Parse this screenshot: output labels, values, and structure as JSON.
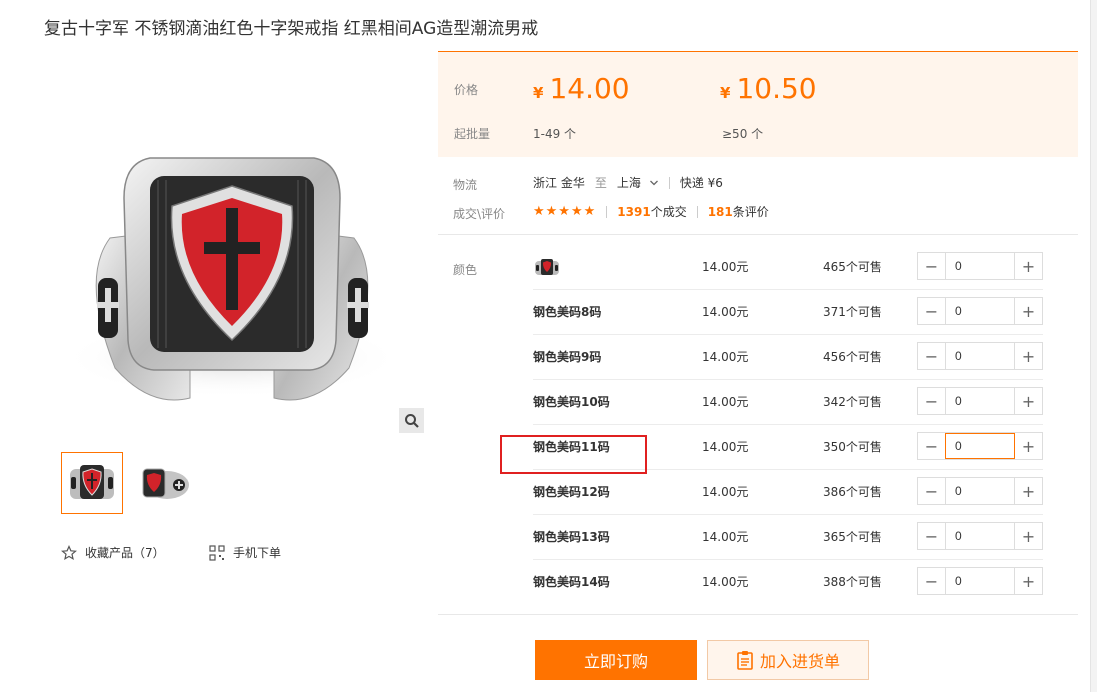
{
  "product": {
    "title": "复古十字军 不锈钢滴油红色十字架戒指 红黑相间AG造型潮流男戒"
  },
  "gallery": {
    "favorite_label": "收藏产品（7）",
    "mobile_label": "手机下单"
  },
  "price_box": {
    "price_label": "价格",
    "currency": "¥",
    "tiers": [
      {
        "price": "14.00",
        "moq": "1-49 个"
      },
      {
        "price": "10.50",
        "moq": "≥50 个"
      }
    ],
    "moq_label": "起批量"
  },
  "logistics": {
    "label": "物流",
    "origin": "浙江 金华",
    "to": "至",
    "destination": "上海",
    "method": "快递 ¥6"
  },
  "reviews": {
    "label": "成交\\评价",
    "stars": "★★★★★",
    "deals_count": "1391",
    "deals_suffix": "个成交",
    "review_count": "181",
    "review_suffix": "条评价"
  },
  "sku": {
    "label": "颜色",
    "rows": [
      {
        "name": "",
        "price": "14.00元",
        "stock": "465个可售",
        "qty": "0"
      },
      {
        "name": "钢色美码8码",
        "price": "14.00元",
        "stock": "371个可售",
        "qty": "0"
      },
      {
        "name": "钢色美码9码",
        "price": "14.00元",
        "stock": "456个可售",
        "qty": "0"
      },
      {
        "name": "钢色美码10码",
        "price": "14.00元",
        "stock": "342个可售",
        "qty": "0"
      },
      {
        "name": "钢色美码11码",
        "price": "14.00元",
        "stock": "350个可售",
        "qty": "0"
      },
      {
        "name": "钢色美码12码",
        "price": "14.00元",
        "stock": "386个可售",
        "qty": "0"
      },
      {
        "name": "钢色美码13码",
        "price": "14.00元",
        "stock": "365个可售",
        "qty": "0"
      },
      {
        "name": "钢色美码14码",
        "price": "14.00元",
        "stock": "388个可售",
        "qty": "0"
      }
    ]
  },
  "actions": {
    "buy_now": "立即订购",
    "add_to_list": "加入进货单"
  },
  "colors": {
    "accent": "#ff7300",
    "price_bg": "#fff5ec",
    "highlight": "#e02020"
  }
}
